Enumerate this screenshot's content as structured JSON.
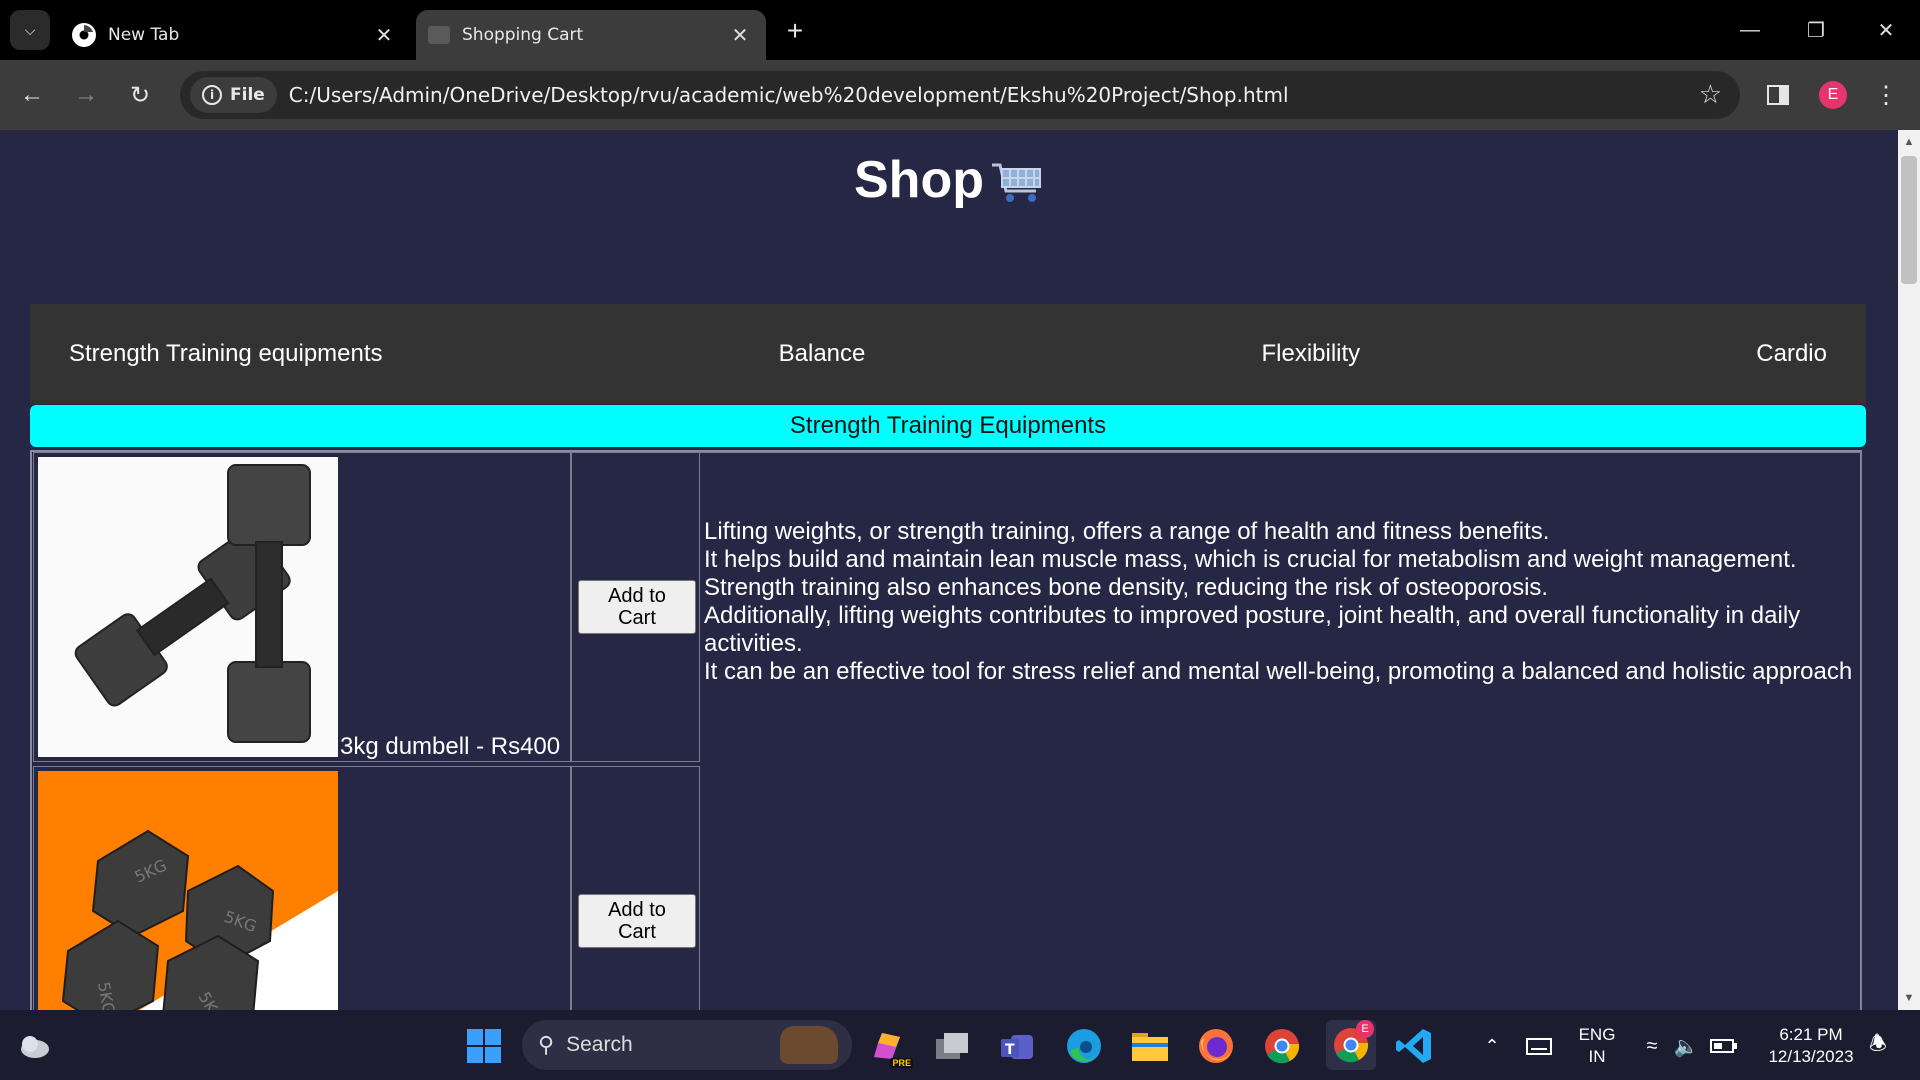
{
  "browser": {
    "tabs": [
      {
        "title": "New Tab",
        "active": false
      },
      {
        "title": "Shopping Cart",
        "active": true
      }
    ],
    "omnibox": {
      "chip_label": "File",
      "url": "C:/Users/Admin/OneDrive/Desktop/rvu/academic/web%20development/Ekshu%20Project/Shop.html"
    },
    "profile_initial": "E"
  },
  "page": {
    "title": "Shop",
    "nav": [
      "Strength Training equipments",
      "Balance",
      "Flexibility",
      "Cardio"
    ],
    "section_heading": "Strength Training Equipments",
    "products": [
      {
        "label": "3kg dumbell - Rs400",
        "button": "Add to Cart"
      },
      {
        "label": "",
        "button": "Add to Cart"
      }
    ],
    "description": [
      "Lifting weights, or strength training, offers a range of health and fitness benefits.",
      "It helps build and maintain lean muscle mass, which is crucial for metabolism and weight management.",
      "Strength training also enhances bone density, reducing the risk of osteoporosis.",
      "Additionally, lifting weights contributes to improved posture, joint health, and overall functionality in daily activities.",
      "It can be an effective tool for stress relief and mental well-being, promoting a balanced and holistic approach"
    ],
    "dumbbell_labels": [
      "5KG",
      "5KG",
      "5KG",
      "5KG"
    ]
  },
  "taskbar": {
    "search_placeholder": "Search",
    "language": "ENG",
    "region": "IN",
    "time": "6:21 PM",
    "date": "12/13/2023",
    "copilot_badge": "PRE"
  },
  "colors": {
    "page_bg": "#262645",
    "nav_bg": "#333333",
    "section_bar": "#00ffff",
    "accent_orange": "#ff7f00"
  }
}
